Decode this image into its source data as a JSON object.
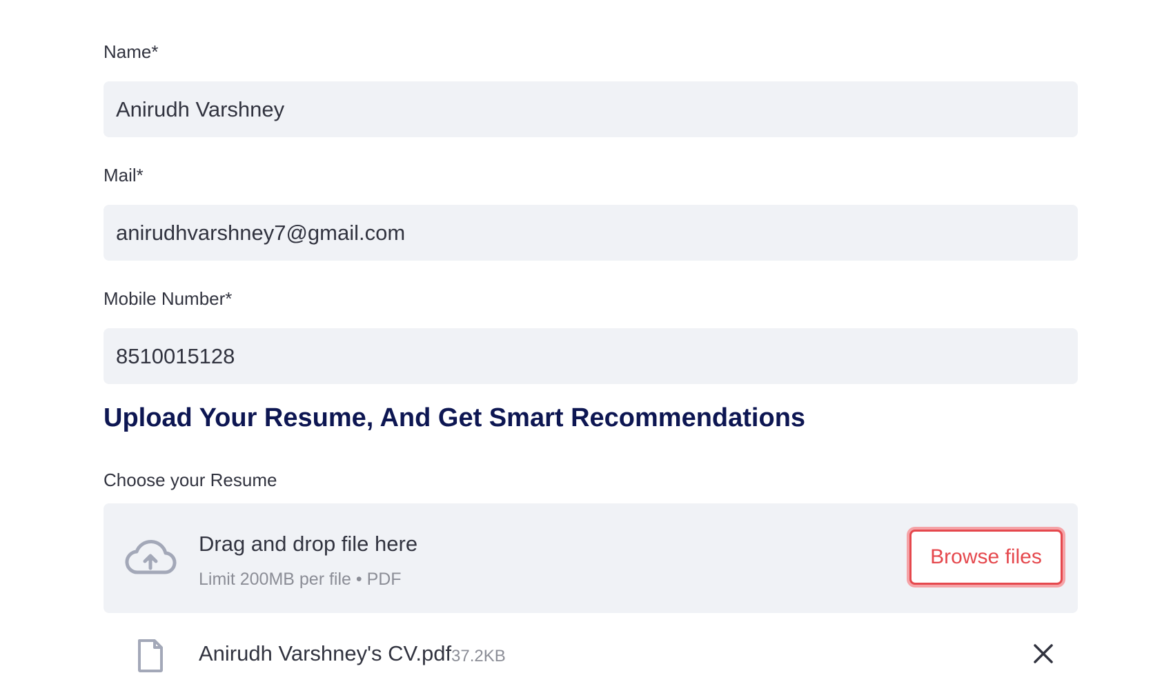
{
  "fields": {
    "name": {
      "label": "Name*",
      "value": "Anirudh Varshney"
    },
    "mail": {
      "label": "Mail*",
      "value": "anirudhvarshney7@gmail.com"
    },
    "mobile": {
      "label": "Mobile Number*",
      "value": "8510015128"
    }
  },
  "upload": {
    "heading": "Upload Your Resume, And Get Smart Recommendations",
    "label": "Choose your Resume",
    "dropzone_title": "Drag and drop file here",
    "dropzone_hint": "Limit 200MB per file • PDF",
    "browse_label": "Browse files",
    "file": {
      "name": "Anirudh Varshney's CV.pdf",
      "size": "37.2KB"
    }
  },
  "icons": {
    "upload": "cloud-upload-icon",
    "file": "file-icon",
    "close": "close-icon"
  },
  "colors": {
    "field_bg": "#f0f2f6",
    "heading": "#0d1652",
    "accent": "#e5484d",
    "muted": "#8b8d96"
  }
}
